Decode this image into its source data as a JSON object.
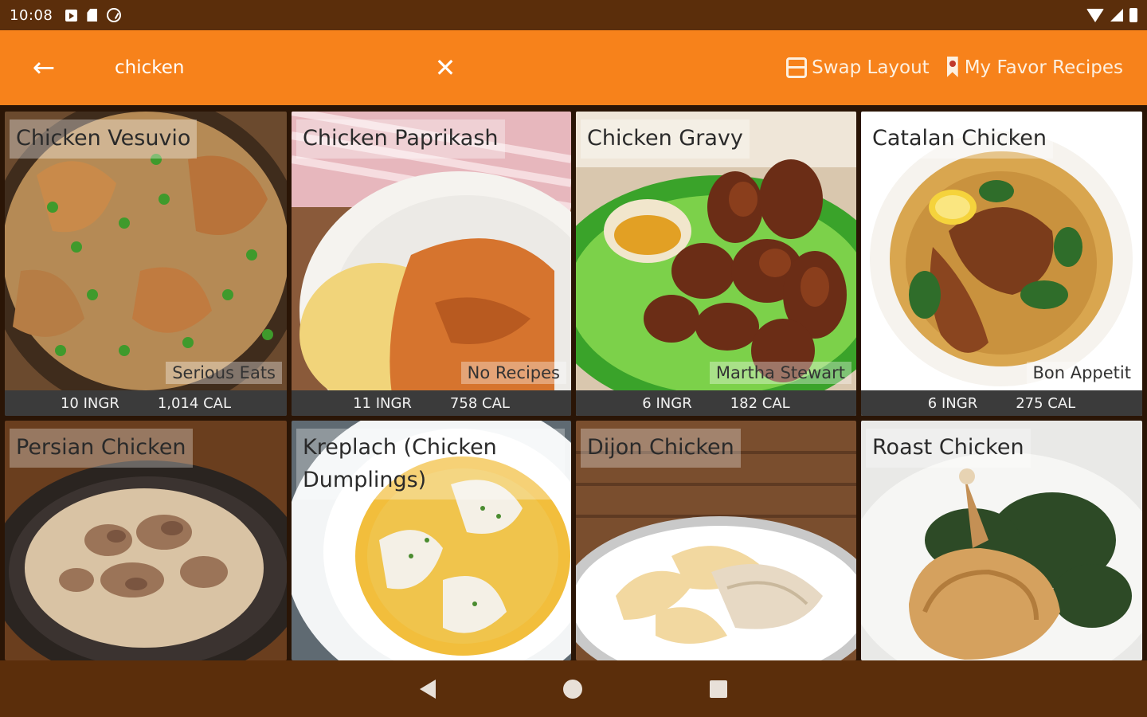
{
  "status_bar": {
    "time": "10:08"
  },
  "toolbar": {
    "search_value": "chicken",
    "clear_glyph": "✕",
    "back_glyph": "←",
    "swap_layout_label": "Swap Layout",
    "favorites_label": "My Favor Recipes"
  },
  "recipes": [
    {
      "title": "Chicken Vesuvio",
      "source": "Serious Eats",
      "ingredients": "10 INGR",
      "calories": "1,014 CAL"
    },
    {
      "title": "Chicken Paprikash",
      "source": "No Recipes",
      "ingredients": "11 INGR",
      "calories": "758 CAL"
    },
    {
      "title": "Chicken Gravy",
      "source": "Martha Stewart",
      "ingredients": "6 INGR",
      "calories": "182 CAL"
    },
    {
      "title": "Catalan Chicken",
      "source": "Bon Appetit",
      "ingredients": "6 INGR",
      "calories": "275 CAL"
    },
    {
      "title": "Persian Chicken"
    },
    {
      "title": "Kreplach (Chicken Dumplings)"
    },
    {
      "title": "Dijon Chicken"
    },
    {
      "title": "Roast Chicken"
    }
  ],
  "icons": {
    "back": "arrow-left-icon",
    "clear": "close-icon",
    "swap": "layout-icon",
    "favorites": "ribbon-icon"
  },
  "colors": {
    "toolbar": "#f7821b",
    "status_bar": "#5b2e0b",
    "stats_bar": "#3b3b3b"
  }
}
